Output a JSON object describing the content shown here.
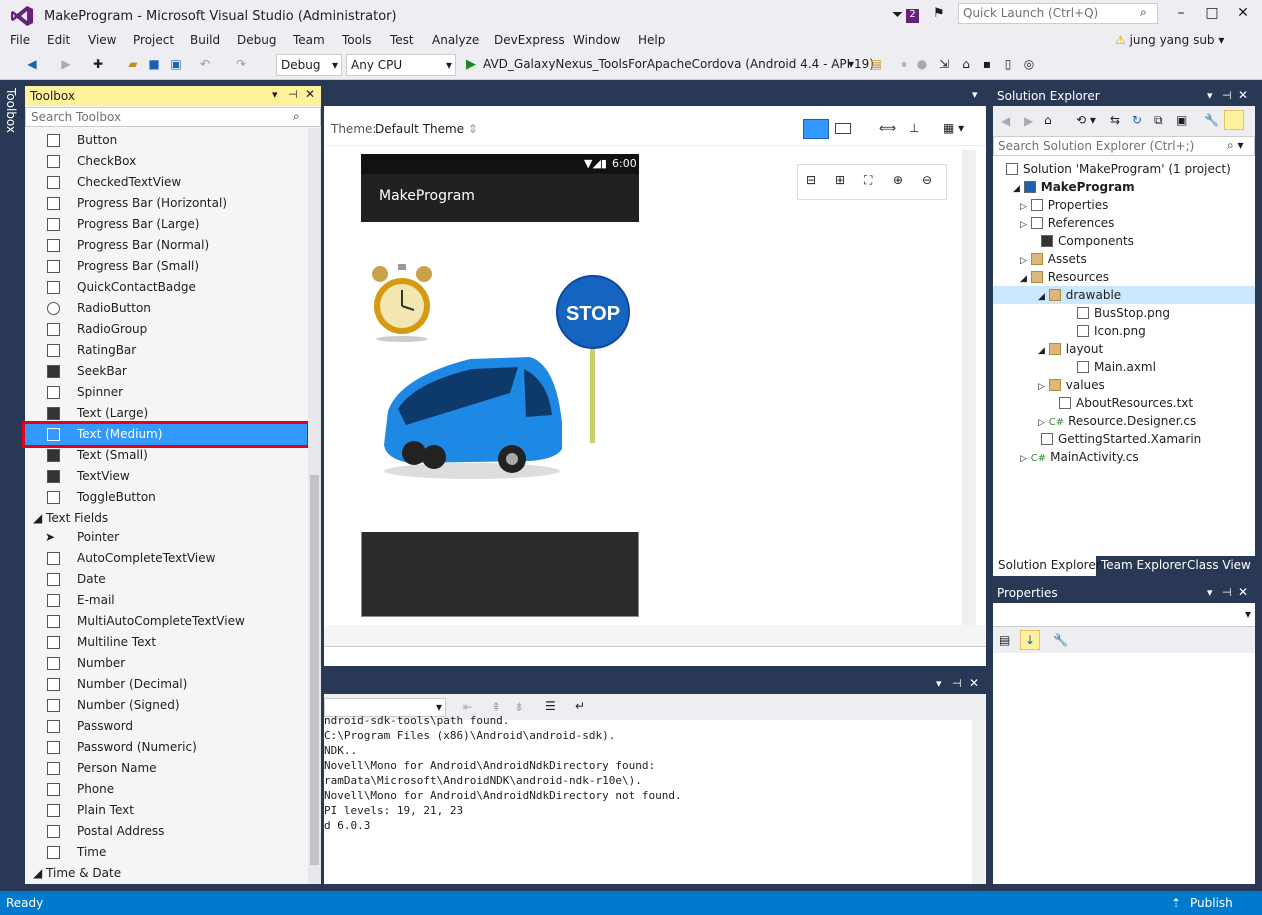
{
  "title_bar": {
    "title": "MakeProgram - Microsoft Visual Studio (Administrator)",
    "notification_count": "2",
    "quick_launch_placeholder": "Quick Launch (Ctrl+Q)"
  },
  "menu": {
    "items": [
      "File",
      "Edit",
      "View",
      "Project",
      "Build",
      "Debug",
      "Team",
      "Tools",
      "Test",
      "Analyze",
      "DevExpress",
      "Window",
      "Help"
    ],
    "user": "jung yang sub"
  },
  "toolbar": {
    "config": "Debug",
    "platform": "Any CPU",
    "run_target": "AVD_GalaxyNexus_ToolsForApacheCordova (Android 4.4 - API 19)"
  },
  "side_tab": "Toolbox",
  "toolbox": {
    "title": "Toolbox",
    "search_placeholder": "Search Toolbox",
    "items": [
      "Button",
      "CheckBox",
      "CheckedTextView",
      "Progress Bar (Horizontal)",
      "Progress Bar (Large)",
      "Progress Bar (Normal)",
      "Progress Bar (Small)",
      "QuickContactBadge",
      "RadioButton",
      "RadioGroup",
      "RatingBar",
      "SeekBar",
      "Spinner",
      "Text (Large)",
      "Text (Medium)",
      "Text (Small)",
      "TextView",
      "ToggleButton"
    ],
    "selected_item": "Text (Medium)",
    "group_text_fields": "Text Fields",
    "text_fields": [
      "Pointer",
      "AutoCompleteTextView",
      "Date",
      "E-mail",
      "MultiAutoCompleteTextView",
      "Multiline Text",
      "Number",
      "Number (Decimal)",
      "Number (Signed)",
      "Password",
      "Password (Numeric)",
      "Person Name",
      "Phone",
      "Plain Text",
      "Postal Address",
      "Time"
    ],
    "group_time_date": "Time & Date"
  },
  "designer": {
    "theme_label": "Theme:",
    "theme_value": "Default Theme",
    "phone_time": "6:00",
    "app_title": "MakeProgram",
    "stop_sign_text": "STOP"
  },
  "output": {
    "lines": [
      "ndroid-sdk-tools\\path found.",
      "C:\\Program Files (x86)\\Android\\android-sdk).",
      "NDK..",
      "Novell\\Mono for Android\\AndroidNdkDirectory found:",
      "ramData\\Microsoft\\AndroidNDK\\android-ndk-r10e\\).",
      "Novell\\Mono for Android\\AndroidNdkDirectory not found.",
      "PI levels: 19, 21, 23",
      "d 6.0.3"
    ]
  },
  "solution_explorer": {
    "title": "Solution Explorer",
    "search_placeholder": "Search Solution Explorer (Ctrl+;)",
    "solution": "Solution 'MakeProgram' (1 project)",
    "project": "MakeProgram",
    "nodes": [
      "Properties",
      "References",
      "Components",
      "Assets",
      "Resources",
      "drawable",
      "BusStop.png",
      "Icon.png",
      "layout",
      "Main.axml",
      "values",
      "AboutResources.txt",
      "Resource.Designer.cs",
      "GettingStarted.Xamarin",
      "MainActivity.cs"
    ],
    "tabs": [
      "Solution Explorer",
      "Team Explorer",
      "Class View"
    ]
  },
  "properties": {
    "title": "Properties"
  },
  "status": {
    "text": "Ready",
    "publish": "Publish"
  },
  "colors": {
    "accent": "#007acc",
    "selection": "#3399ff",
    "highlight_border": "#e3001b",
    "toolbox_header": "#fff29d"
  }
}
